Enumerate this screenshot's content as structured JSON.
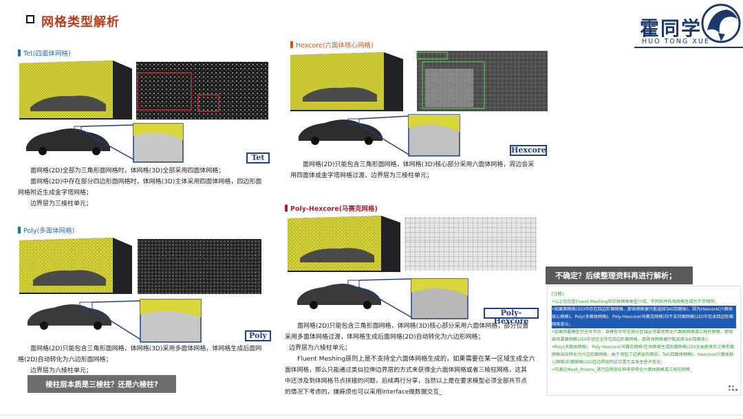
{
  "header": {
    "title": "网格类型解析",
    "logo_cn": "霍同学",
    "logo_en": "HUO TONG XUE"
  },
  "sections": {
    "tet": {
      "heading": "Tet(四面体网格)",
      "label": "Tet",
      "lines": [
        "面网格(2D)全部为三角形面网格时，体网格(3D)全部采用四面体网格；",
        "面网格(2D)中存在部分四边形面网格时，体网格(3D)主体采用四面体网格，四边形面",
        "网格附近生成金字塔网格；",
        "边界层为三棱柱单元；"
      ]
    },
    "hexcore": {
      "heading": "Hexcore(六面体核心网格)",
      "label": "Hexcore",
      "lines": [
        "面网格(2D)只能包含三角形面网格，体网格(3D)核心部分采用六面体网格，周边会采",
        "用四面体或金字塔网格过渡，边界层为三棱柱单元；"
      ]
    },
    "poly": {
      "heading": "Poly(多面体网格)",
      "label": "Poly",
      "lines": [
        "面网格(2D)只能包含三角形面网格，体网格(3D)采用多面体网格，体网格生成后面网",
        "格(2D)自动转化为六边形面网格；",
        "边界层为六棱柱单元；"
      ]
    },
    "polyhex": {
      "heading": "Poly-Hexcore(马赛克网格)",
      "label": "Poly-Hexcore",
      "lines": [
        "面网格(2D)只能包含三角形面网格，体网格(3D)核心部分采用六面体网格，部分位置",
        "采用多面体网格过渡，体网格生成后面网格(2D)自动转化为六边形网格；",
        "边界层为六棱柱单元；"
      ],
      "blue_lines": [
        "Fluent Meshing原则上是不支持全六面体网格生成的，如果需要在某一区域生成全六",
        "面体网格，那么只能通过类似拉伸边界层的方式来获得全六面体网格或者三棱柱网格，这其",
        "中还涉及到体网格节点拼接的问题，后续再行分享，当然以上是在要求模型必须全部共节点",
        "的情况下考虑的，嫌麻烦也可以采用Interface做数据交互_"
      ]
    }
  },
  "banners": {
    "prism_question": "棱柱层本质是三棱柱？还是六棱柱?",
    "uncertain": "不确定？后续整理资料再进行解析；"
  },
  "notes": {
    "title": "[注释]",
    "items": [
      "•以上仅仅是Fluent Meshing中的体网格类型介绍，不同软件的体网格生成也不尽相同；",
      "•如果面网格(2D)中存在四边形面网格，那体网格便只能选择Tet(四面体)，因为Hexcore(六面体核心网格)、Poly(多面体网格)、Poly-Hexcore(马赛克网格)均不支持面网格(2D)中包含四边形面网格单元；",
      "•如果想要模型完全共节点，且模型中存在部分区域必须要使用全六面体网格或三棱柱网格，那就麻烦要面网格(2D)中坚定全存在四边形面网格，那其体网格便只能选择Tet(四面体)；",
      "•Poly(多面体网格)、Poly-Hexcore(马赛克网格)在体网格生成后面网格(2D)全由原来的三角形面网格自动转化为六边形面网格，由于添加了边界层的原因，Tet(四面体网格)、Hexcore(六面体核心网格)的面网格(2D)在边界层附近位置也会发生些许变化；",
      "•可通过Mesh_Prisms_进行边界层拉伸来获得全六面体网格或三棱柱网格_"
    ]
  },
  "colors": {
    "title_red": "#c0391b",
    "section_blue": "#1e6fb5",
    "section_orange": "#d4541b",
    "section_darkred": "#b01c2e",
    "logo_navy": "#1b3a6b",
    "mesh_yellow": "#d9d63a",
    "label_navy": "#1d3e8a",
    "note_green": "#2a9c2a"
  }
}
